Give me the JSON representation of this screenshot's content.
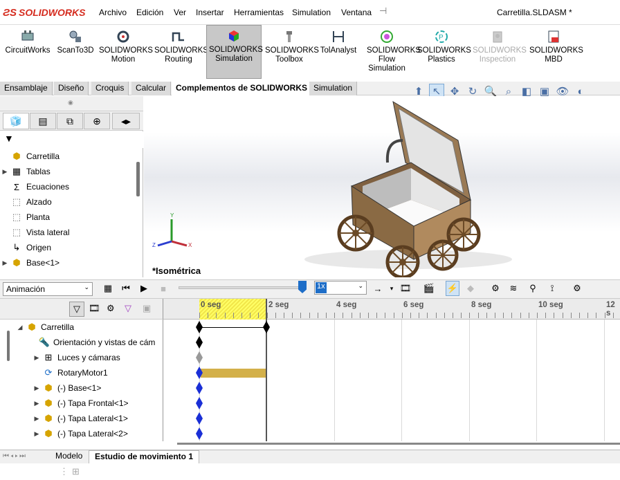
{
  "app": {
    "brand": "SOLIDWORKS",
    "document_title": "Carretilla.SLDASM *"
  },
  "menu": [
    "Archivo",
    "Edición",
    "Ver",
    "Insertar",
    "Herramientas",
    "Simulation",
    "Ventana"
  ],
  "commands": [
    {
      "label": "CircuitWorks",
      "icon": "circuitworks-icon"
    },
    {
      "label": "ScanTo3D",
      "icon": "scanto3d-icon"
    },
    {
      "label": "SOLIDWORKS Motion",
      "icon": "motion-icon"
    },
    {
      "label": "SOLIDWORKS Routing",
      "icon": "routing-icon"
    },
    {
      "label": "SOLIDWORKS Simulation",
      "icon": "simulation-icon",
      "active": true
    },
    {
      "label": "SOLIDWORKS Toolbox",
      "icon": "toolbox-icon"
    },
    {
      "label": "TolAnalyst",
      "icon": "tolanalyst-icon"
    },
    {
      "label": "SOLIDWORKS Flow Simulation",
      "icon": "flow-simulation-icon"
    },
    {
      "label": "SOLIDWORKS Plastics",
      "icon": "plastics-icon"
    },
    {
      "label": "SOLIDWORKS Inspection",
      "icon": "inspection-icon",
      "disabled": true
    },
    {
      "label": "SOLIDWORKS MBD",
      "icon": "mbd-icon"
    }
  ],
  "tabs": [
    "Ensamblaje",
    "Diseño",
    "Croquis",
    "Calcular",
    "Complementos de SOLIDWORKS",
    "Simulation"
  ],
  "selected_tab": "Complementos de SOLIDWORKS",
  "feature_tree": [
    {
      "label": "Carretilla",
      "icon": "assembly-icon",
      "expand": false
    },
    {
      "label": "Tablas",
      "icon": "tables-icon",
      "expand": true
    },
    {
      "label": "Ecuaciones",
      "icon": "equations-icon",
      "expand": false
    },
    {
      "label": "Alzado",
      "icon": "plane-icon",
      "expand": false
    },
    {
      "label": "Planta",
      "icon": "plane-icon",
      "expand": false
    },
    {
      "label": "Vista lateral",
      "icon": "plane-icon",
      "expand": false
    },
    {
      "label": "Origen",
      "icon": "origin-icon",
      "expand": false
    },
    {
      "label": "Base<1>",
      "icon": "part-icon",
      "expand": true
    }
  ],
  "viewport": {
    "view_label": "*Isométrica",
    "triad": {
      "x": "X",
      "y": "Y",
      "z": "Z"
    }
  },
  "animation": {
    "type": "Animación",
    "speed": "1x",
    "time_labels": [
      "0 seg",
      "2 seg",
      "4 seg",
      "6 seg",
      "8 seg",
      "10 seg",
      "12 s"
    ]
  },
  "motion_tree": [
    {
      "label": "Carretilla",
      "icon": "assembly-icon",
      "expand": "open",
      "key_color": "#000000",
      "end_key": true
    },
    {
      "label": "Orientación y vistas de cám",
      "icon": "camera-orientation-icon",
      "expand": "none",
      "key_color": "#000000"
    },
    {
      "label": "Luces y cámaras",
      "icon": "lights-icon",
      "expand": "closed",
      "key_color": "#999999"
    },
    {
      "label": "RotaryMotor1",
      "icon": "motor-icon",
      "expand": "none",
      "key_color": "#1a2fd6"
    },
    {
      "label": "(-) Base<1>",
      "icon": "part-icon",
      "expand": "closed",
      "key_color": "#1a2fd6"
    },
    {
      "label": "(-) Tapa Frontal<1>",
      "icon": "part-icon",
      "expand": "closed",
      "key_color": "#1a2fd6"
    },
    {
      "label": "(-) Tapa Lateral<1>",
      "icon": "part-icon",
      "expand": "closed",
      "key_color": "#1a2fd6"
    },
    {
      "label": "(-) Tapa Lateral<2>",
      "icon": "part-icon",
      "expand": "closed",
      "key_color": "#1a2fd6"
    }
  ],
  "bottom_tabs": [
    "Modelo",
    "Estudio de movimiento 1"
  ],
  "selected_bottom_tab": "Estudio de movimiento 1",
  "colors": {
    "brand": "#d52b1e",
    "timebar": "#f5ec55",
    "motor_bar": "#d3b04a",
    "key_blue": "#1a2fd6"
  }
}
